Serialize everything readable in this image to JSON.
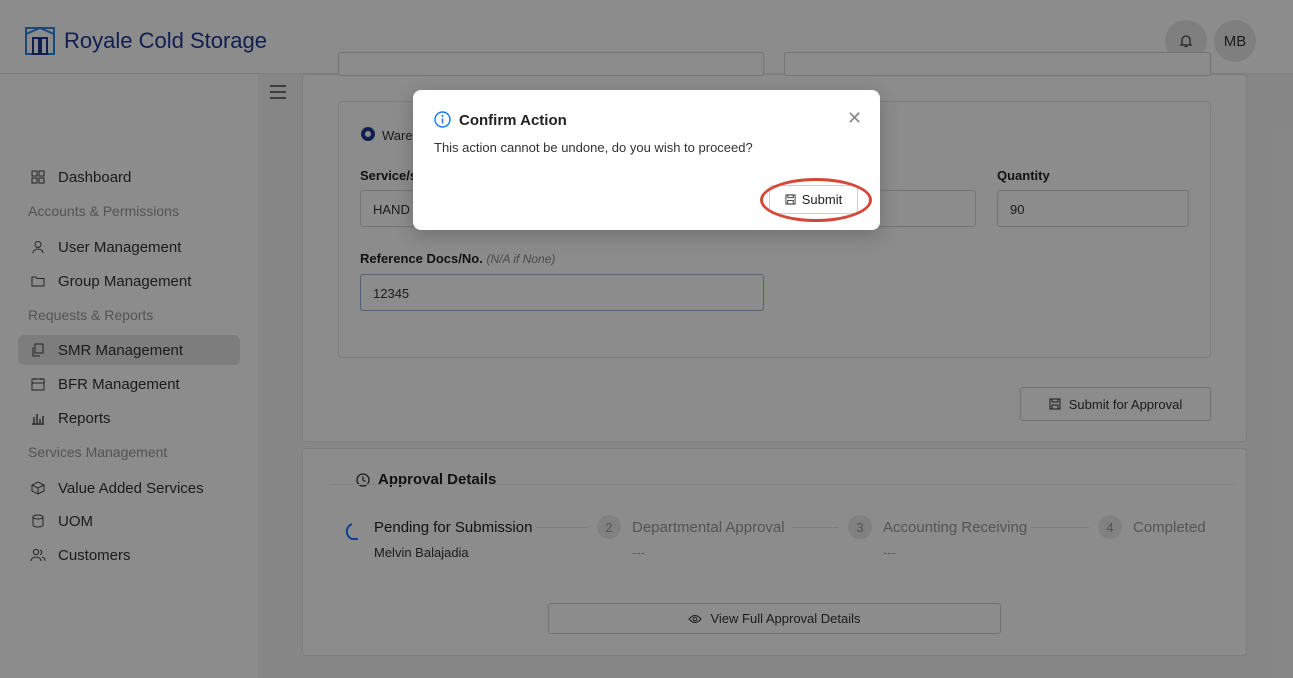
{
  "header": {
    "brand": "Royale Cold Storage",
    "user_initials": "MB",
    "icons": {
      "logo": "warehouse-logo",
      "notifications": "bell-icon"
    }
  },
  "sidebar": {
    "items": [
      {
        "label": "Dashboard",
        "icon": "grid-icon"
      },
      {
        "section": "Accounts & Permissions"
      },
      {
        "label": "User Management",
        "icon": "user-icon"
      },
      {
        "label": "Group Management",
        "icon": "folder-icon"
      },
      {
        "section": "Requests & Reports"
      },
      {
        "label": "SMR Management",
        "icon": "copy-icon",
        "active": true
      },
      {
        "label": "BFR Management",
        "icon": "calendar-icon"
      },
      {
        "label": "Reports",
        "icon": "bar-chart-icon"
      },
      {
        "section": "Services Management"
      },
      {
        "label": "Value Added Services",
        "icon": "box-icon"
      },
      {
        "label": "UOM",
        "icon": "database-icon"
      },
      {
        "label": "Customers",
        "icon": "users-icon"
      }
    ]
  },
  "form": {
    "radio_label": "Warel",
    "service_label": "Service/s",
    "service_value": "HAND",
    "quantity_label": "Quantity",
    "quantity_value": "90",
    "ref_label": "Reference Docs/No.",
    "ref_hint": "(N/A if None)",
    "ref_value": "12345",
    "submit_approval_label": "Submit for Approval"
  },
  "approval": {
    "title": "Approval Details",
    "steps": [
      {
        "num": "",
        "title": "Pending for Submission",
        "sub": "Melvin Balajadia"
      },
      {
        "num": "2",
        "title": "Departmental Approval",
        "sub": "---"
      },
      {
        "num": "3",
        "title": "Accounting Receiving",
        "sub": "---"
      },
      {
        "num": "4",
        "title": "Completed",
        "sub": ""
      }
    ],
    "view_full_label": "View Full Approval Details"
  },
  "modal": {
    "title": "Confirm Action",
    "message": "This action cannot be undone, do you wish to proceed?",
    "submit_label": "Submit",
    "colors": {
      "info": "#1677ff",
      "highlight": "#d6473a"
    }
  }
}
